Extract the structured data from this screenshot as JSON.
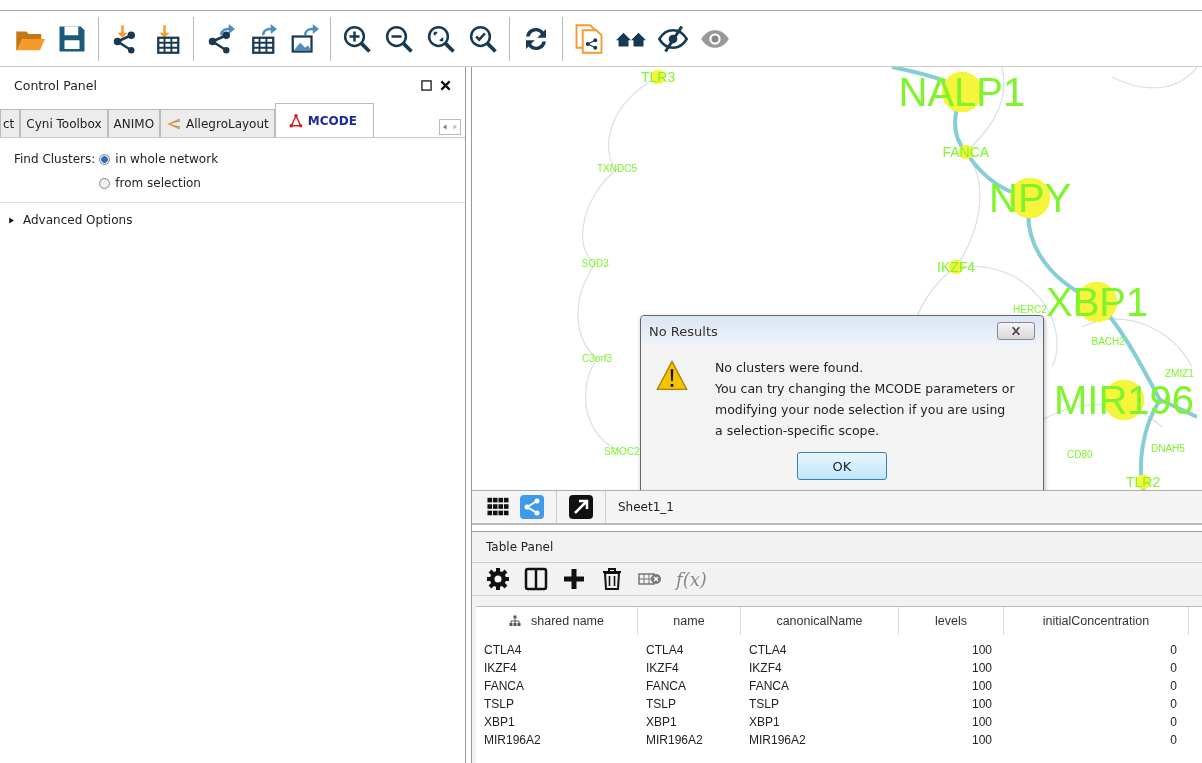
{
  "control_panel": {
    "title": "Control Panel",
    "tabs": [
      {
        "label": "ct",
        "selected": false
      },
      {
        "label": "Cyni Toolbox",
        "selected": false
      },
      {
        "label": "ANIMO",
        "selected": false
      },
      {
        "label": "AllegroLayout",
        "selected": false
      },
      {
        "label": "MCODE",
        "selected": true
      }
    ],
    "find_clusters": {
      "label": "Find Clusters:",
      "options": [
        {
          "label": "in whole network",
          "selected": true
        },
        {
          "label": "from selection",
          "selected": false
        }
      ]
    },
    "advanced_options": {
      "label": "Advanced Options",
      "expanded": false
    }
  },
  "network": {
    "nodes": [
      {
        "label": "TLR3",
        "kind": "small"
      },
      {
        "label": "NALP1",
        "kind": "large"
      },
      {
        "label": "FANCA",
        "kind": "small"
      },
      {
        "label": "TXNDC5",
        "kind": "tiny"
      },
      {
        "label": "NPY",
        "kind": "large"
      },
      {
        "label": "SOD3",
        "kind": "tiny"
      },
      {
        "label": "IKZF4",
        "kind": "small"
      },
      {
        "label": "HERC2",
        "kind": "tiny"
      },
      {
        "label": "XBP1",
        "kind": "large"
      },
      {
        "label": "BACH2",
        "kind": "tiny"
      },
      {
        "label": "C3orf3",
        "kind": "tiny"
      },
      {
        "label": "ZMIZ1",
        "kind": "tiny"
      },
      {
        "label": "MIR196",
        "kind": "large"
      },
      {
        "label": "SMOC2",
        "kind": "tiny"
      },
      {
        "label": "CD80",
        "kind": "tiny"
      },
      {
        "label": "DNAH5",
        "kind": "tiny"
      },
      {
        "label": "TLR2",
        "kind": "small"
      }
    ]
  },
  "view_tabs": {
    "sheet": "Sheet1_1"
  },
  "dialog": {
    "title": "No Results",
    "lines": [
      "No clusters were found.",
      "You can try changing the MCODE parameters or",
      "modifying your node selection if you are using",
      "a selection-specific scope."
    ],
    "button": "OK"
  },
  "table_panel": {
    "title": "Table Panel",
    "formula_button": "f(x)",
    "columns": [
      "shared name",
      "name",
      "canonicalName",
      "levels",
      "initialConcentration"
    ],
    "rows": [
      [
        "CTLA4",
        "CTLA4",
        "CTLA4",
        "100",
        "0"
      ],
      [
        "IKZF4",
        "IKZF4",
        "IKZF4",
        "100",
        "0"
      ],
      [
        "FANCA",
        "FANCA",
        "FANCA",
        "100",
        "0"
      ],
      [
        "TSLP",
        "TSLP",
        "TSLP",
        "100",
        "0"
      ],
      [
        "XBP1",
        "XBP1",
        "XBP1",
        "100",
        "0"
      ],
      [
        "MIR196A2",
        "MIR196A2",
        "MIR196A2",
        "100",
        "0"
      ]
    ]
  }
}
